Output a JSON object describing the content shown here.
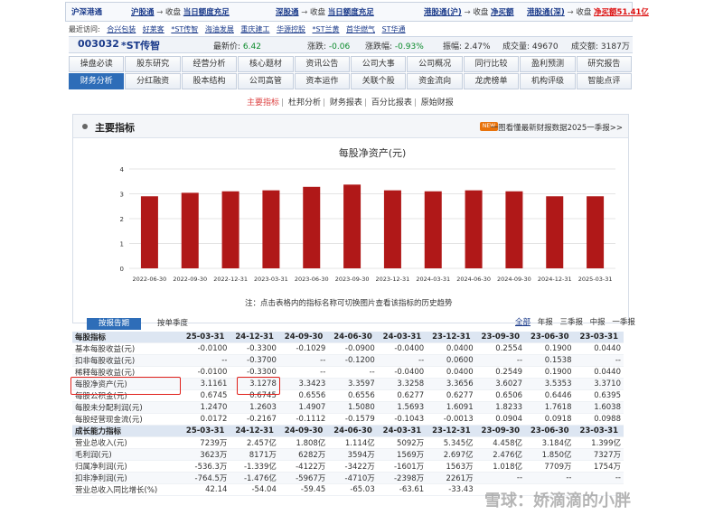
{
  "ticker": {
    "logo": "沪深港通",
    "items": [
      {
        "name": "沪股通",
        "sep": "→",
        "status": "收盘",
        "detail": "当日额度充足"
      },
      {
        "name": "深股通",
        "sep": "→",
        "status": "收盘",
        "detail": "当日额度充足"
      },
      {
        "name": "港股通(沪)",
        "sep": "→",
        "status": "收盘",
        "detail": "净买额"
      },
      {
        "name": "港股通(深)",
        "sep": "→",
        "status": "收盘",
        "detail": "净买额51.41亿"
      }
    ]
  },
  "recent": {
    "label": "最近访问:",
    "items": [
      "合兴包装",
      "好莱客",
      "*ST传智",
      "海油发展",
      "重庆建工",
      "华源控股",
      "*ST兰黄",
      "首华燃气",
      "ST华通"
    ]
  },
  "stock": {
    "code": "003032",
    "name": "*ST传智",
    "price_label": "最新价:",
    "price": "6.42",
    "change_label": "涨跌:",
    "change": "-0.06",
    "pct_label": "涨跌幅:",
    "pct": "-0.93%",
    "amp_label": "振幅:",
    "amp": "2.47%",
    "vol_label": "成交量:",
    "vol": "49670",
    "amt_label": "成交额:",
    "amt": "3187万"
  },
  "tabs": {
    "row1": [
      "操盘必读",
      "股东研究",
      "经营分析",
      "核心题材",
      "资讯公告",
      "公司大事",
      "公司概况",
      "同行比较",
      "盈利预测",
      "研究报告"
    ],
    "row2": [
      "财务分析",
      "分红融资",
      "股本结构",
      "公司高管",
      "资本运作",
      "关联个股",
      "资金流向",
      "龙虎榜单",
      "机构评级",
      "智能点评"
    ],
    "active": "财务分析"
  },
  "subnav": [
    "主要指标",
    "杜邦分析",
    "财务报表",
    "百分比报表",
    "原始财报"
  ],
  "panel": {
    "title": "主要指标",
    "badge": "NEW",
    "link": "一图看懂最新财报数据2025一季报>>",
    "note": "注：点击表格内的指标名称可切换图片查看该指标的历史趋势"
  },
  "chart_data": {
    "type": "bar",
    "title": "每股净资产(元)",
    "categories": [
      "2022-06-30",
      "2022-09-30",
      "2022-12-31",
      "2023-03-31",
      "2023-06-30",
      "2023-09-30",
      "2023-12-31",
      "2024-03-31",
      "2024-06-30",
      "2024-09-30",
      "2024-12-31",
      "2025-03-31"
    ],
    "values": [
      2.9,
      3.04,
      3.1,
      3.14,
      3.28,
      3.37,
      3.14,
      3.1,
      3.14,
      3.1,
      2.9,
      2.9
    ],
    "ylim": [
      0,
      4
    ],
    "yticks": [
      "4",
      "3",
      "2",
      "1",
      "0"
    ],
    "color": "#b01818",
    "grid": true
  },
  "toggles": {
    "report": "按报告期",
    "quarter": "按单季度",
    "links": [
      "全部",
      "年报",
      "三季报",
      "中报",
      "一季报"
    ]
  },
  "table": {
    "header1": [
      "每股指标",
      "25-03-31",
      "24-12-31",
      "24-09-30",
      "24-06-30",
      "24-03-31",
      "23-12-31",
      "23-09-30",
      "23-06-30",
      "23-03-31"
    ],
    "rows1": [
      [
        "基本每股收益(元)",
        "-0.0100",
        "-0.3300",
        "-0.1029",
        "-0.0900",
        "-0.0400",
        "0.0400",
        "0.2554",
        "0.1900",
        "0.0440"
      ],
      [
        "扣非每股收益(元)",
        "--",
        "-0.3700",
        "--",
        "-0.1200",
        "--",
        "0.0600",
        "--",
        "0.1538",
        "--"
      ],
      [
        "稀释每股收益(元)",
        "-0.0100",
        "-0.3300",
        "--",
        "--",
        "-0.0400",
        "0.0400",
        "0.2549",
        "0.1900",
        "0.0440"
      ],
      [
        "每股净资产(元)",
        "3.1161",
        "3.1278",
        "3.3423",
        "3.3597",
        "3.3258",
        "3.3656",
        "3.6027",
        "3.5353",
        "3.3710"
      ],
      [
        "每股公积金(元)",
        "0.6745",
        "0.6745",
        "0.6556",
        "0.6556",
        "0.6277",
        "0.6277",
        "0.6506",
        "0.6446",
        "0.6395"
      ],
      [
        "每股未分配利润(元)",
        "1.2470",
        "1.2603",
        "1.4907",
        "1.5080",
        "1.5693",
        "1.6091",
        "1.8233",
        "1.7618",
        "1.6038"
      ],
      [
        "每股经营现金流(元)",
        "0.0172",
        "-0.2167",
        "-0.1112",
        "-0.1579",
        "-0.1043",
        "-0.0013",
        "0.0904",
        "0.0918",
        "0.0988"
      ]
    ],
    "header2": [
      "成长能力指标",
      "25-03-31",
      "24-12-31",
      "24-09-30",
      "24-06-30",
      "24-03-31",
      "23-12-31",
      "23-09-30",
      "23-06-30",
      "23-03-31"
    ],
    "rows2": [
      [
        "营业总收入(元)",
        "7239万",
        "2.457亿",
        "1.808亿",
        "1.114亿",
        "5092万",
        "5.345亿",
        "4.458亿",
        "3.184亿",
        "1.399亿"
      ],
      [
        "毛利润(元)",
        "3623万",
        "8171万",
        "6282万",
        "3594万",
        "1569万",
        "2.697亿",
        "2.476亿",
        "1.850亿",
        "7327万"
      ],
      [
        "归属净利润(元)",
        "-536.3万",
        "-1.339亿",
        "-4122万",
        "-3422万",
        "-1601万",
        "1563万",
        "1.018亿",
        "7709万",
        "1754万"
      ],
      [
        "扣非净利润(元)",
        "-764.5万",
        "-1.476亿",
        "-5967万",
        "-4710万",
        "-2398万",
        "2261万",
        "--",
        "--",
        "--"
      ],
      [
        "营业总收入同比增长(%)",
        "42.14",
        "-54.04",
        "-59.45",
        "-65.03",
        "-63.61",
        "-33.43",
        "",
        "",
        ""
      ]
    ]
  },
  "watermark": "雪球：娇滴滴的小胖"
}
